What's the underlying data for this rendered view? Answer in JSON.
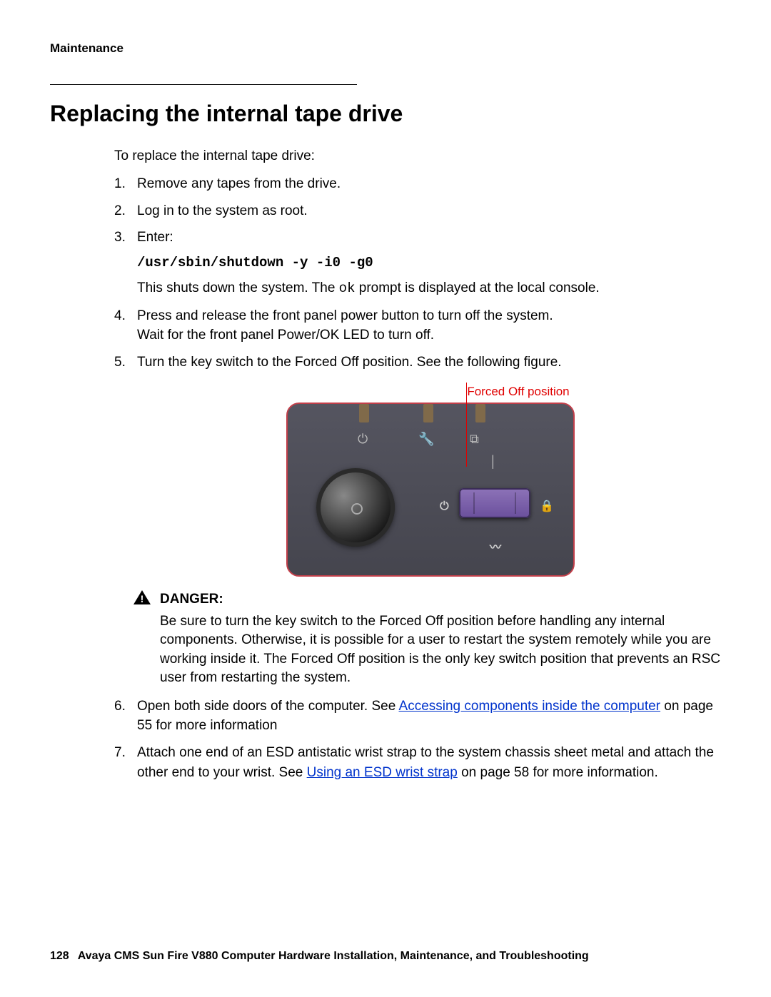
{
  "header": {
    "section": "Maintenance"
  },
  "title": "Replacing the internal tape drive",
  "intro": "To replace the internal tape drive:",
  "steps": {
    "s1": "Remove any tapes from the drive.",
    "s2": "Log in to the system as root.",
    "s3_label": "Enter:",
    "s3_cmd": "/usr/sbin/shutdown -y -i0 -g0",
    "s3_after_a": "This shuts down the system. The ",
    "s3_ok": "ok",
    "s3_after_b": " prompt is displayed at the local console.",
    "s4_a": "Press and release the front panel power button to turn off the system.",
    "s4_b": "Wait for the front panel Power/OK LED to turn off.",
    "s5": "Turn the key switch to the Forced Off position. See the following figure.",
    "s6_a": "Open both side doors of the computer. See ",
    "s6_link": "Accessing components inside the computer",
    "s6_b": " on page 55 for more information",
    "s7_a": "Attach one end of an ESD antistatic wrist strap to the system chassis sheet metal and attach the other end to your wrist. See ",
    "s7_link": "Using an ESD wrist strap",
    "s7_b": " on page 58 for more information."
  },
  "figure": {
    "caption": "Forced Off position"
  },
  "danger": {
    "label": "DANGER:",
    "text": "Be sure to turn the key switch to the Forced Off position before handling any internal components. Otherwise, it is possible for a user to restart the system remotely while you are working inside it. The Forced Off position is the only key switch position that prevents an RSC user from restarting the system."
  },
  "footer": {
    "page": "128",
    "title": "Avaya CMS Sun Fire V880 Computer Hardware Installation, Maintenance, and Troubleshooting"
  }
}
